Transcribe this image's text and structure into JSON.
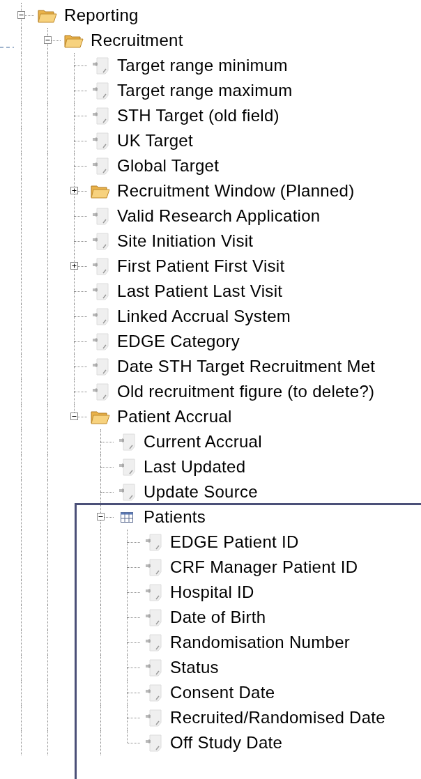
{
  "tree": {
    "more_below": true,
    "items": [
      {
        "kind": "folder",
        "label": "Reporting",
        "expanded": true,
        "selected": false,
        "more_children_below": true,
        "children": [
          {
            "kind": "folder",
            "label": "Recruitment",
            "expanded": true,
            "selected": false,
            "more_children_below": false,
            "children": [
              {
                "kind": "field",
                "label": "Target range minimum",
                "selected": false
              },
              {
                "kind": "field",
                "label": "Target range maximum",
                "selected": false
              },
              {
                "kind": "field",
                "label": "STH Target (old field)",
                "selected": false
              },
              {
                "kind": "field",
                "label": "UK Target",
                "selected": false
              },
              {
                "kind": "field",
                "label": "Global Target",
                "selected": false
              },
              {
                "kind": "folder",
                "label": "Recruitment Window (Planned)",
                "expanded": false,
                "selected": false
              },
              {
                "kind": "field",
                "label": "Valid Research Application",
                "selected": false
              },
              {
                "kind": "field",
                "label": "Site Initiation Visit",
                "selected": false
              },
              {
                "kind": "field",
                "label": "First Patient First Visit",
                "expanded": false,
                "selected": false
              },
              {
                "kind": "field",
                "label": "Last Patient Last Visit",
                "selected": false
              },
              {
                "kind": "field",
                "label": "Linked Accrual System",
                "selected": false
              },
              {
                "kind": "field",
                "label": "EDGE Category",
                "selected": false
              },
              {
                "kind": "field",
                "label": "Date STH Target Recruitment Met",
                "selected": false
              },
              {
                "kind": "field",
                "label": "Old recruitment figure (to delete?)",
                "selected": false
              },
              {
                "kind": "folder",
                "label": "Patient Accrual",
                "expanded": true,
                "selected": false,
                "more_children_below": true,
                "children": [
                  {
                    "kind": "field",
                    "label": "Current Accrual",
                    "selected": false
                  },
                  {
                    "kind": "field",
                    "label": "Last Updated",
                    "selected": false
                  },
                  {
                    "kind": "field",
                    "label": "Update Source",
                    "selected": false
                  },
                  {
                    "kind": "table",
                    "label": "Patients",
                    "expanded": true,
                    "selected": true,
                    "more_children_below": false,
                    "children": [
                      {
                        "kind": "field",
                        "label": "EDGE Patient ID",
                        "selected": false
                      },
                      {
                        "kind": "field",
                        "label": "CRF Manager Patient ID",
                        "selected": false
                      },
                      {
                        "kind": "field",
                        "label": "Hospital ID",
                        "selected": false
                      },
                      {
                        "kind": "field",
                        "label": "Date of Birth",
                        "selected": false
                      },
                      {
                        "kind": "field",
                        "label": "Randomisation Number",
                        "selected": false
                      },
                      {
                        "kind": "field",
                        "label": "Status",
                        "selected": false
                      },
                      {
                        "kind": "field",
                        "label": "Consent Date",
                        "selected": false
                      },
                      {
                        "kind": "field",
                        "label": "Recruited/Randomised Date",
                        "selected": false
                      },
                      {
                        "kind": "field",
                        "label": "Off Study Date",
                        "selected": false
                      }
                    ]
                  }
                ]
              }
            ]
          }
        ]
      }
    ]
  }
}
